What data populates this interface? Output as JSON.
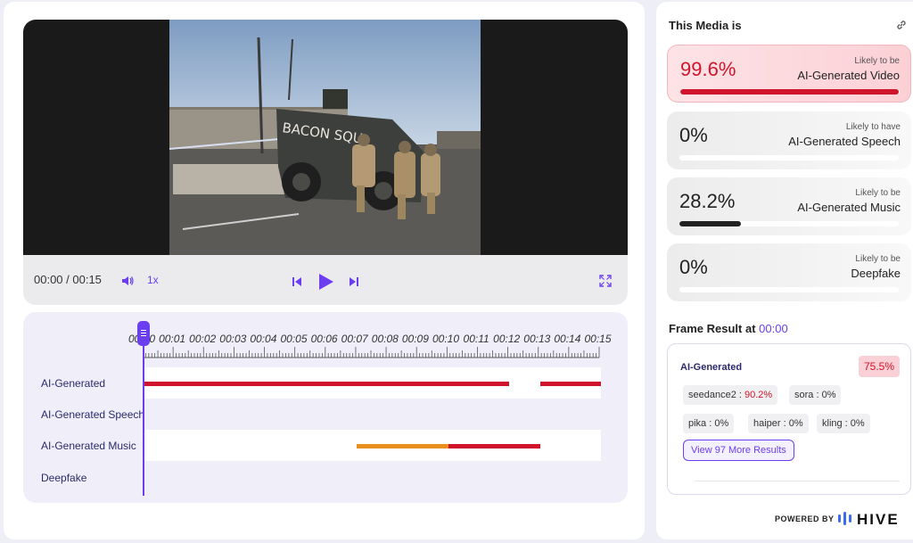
{
  "player": {
    "time": "00:00 / 00:15",
    "speed": "1x",
    "icons": [
      "volume-icon",
      "skip-back-icon",
      "play-icon",
      "skip-forward-icon",
      "fullscreen-icon"
    ],
    "video_text": "BACON SQU"
  },
  "timeline": {
    "ticks": [
      "00:00",
      "00:01",
      "00:02",
      "00:03",
      "00:04",
      "00:05",
      "00:06",
      "00:07",
      "00:08",
      "00:09",
      "00:10",
      "00:11",
      "00:12",
      "00:13",
      "00:14",
      "00:15"
    ],
    "tracks": [
      {
        "label": "AI-Generated",
        "segments": [
          {
            "start": 0,
            "end": 12.0,
            "color": "#d0142c"
          },
          {
            "start": 13.0,
            "end": 15.0,
            "color": "#d0142c"
          }
        ]
      },
      {
        "label": "AI-Generated Speech",
        "segments": []
      },
      {
        "label": "AI-Generated Music",
        "segments": [
          {
            "start": 7.0,
            "end": 10.0,
            "color": "#e8901e"
          },
          {
            "start": 10.0,
            "end": 13.0,
            "color": "#d0142c"
          }
        ]
      },
      {
        "label": "Deepfake",
        "segments": []
      }
    ]
  },
  "sidebar": {
    "title": "This Media is",
    "cards": [
      {
        "pct": "99.6%",
        "small": "Likely to be",
        "big": "AI-Generated Video",
        "fill": 0.996,
        "color": "#d0142c"
      },
      {
        "pct": "0%",
        "small": "Likely to have",
        "big": "AI-Generated Speech",
        "fill": 0,
        "color": "#222222"
      },
      {
        "pct": "28.2%",
        "small": "Likely to be",
        "big": "AI-Generated Music",
        "fill": 0.282,
        "color": "#222222"
      },
      {
        "pct": "0%",
        "small": "Likely to be",
        "big": "Deepfake",
        "fill": 0,
        "color": "#222222"
      }
    ],
    "frame_title": "Frame Result at",
    "frame_time": "00:00",
    "frame_label": "AI-Generated",
    "frame_score": "75.5%",
    "chips": [
      {
        "name": "seedance2",
        "value": "90.2%",
        "red": true
      },
      {
        "name": "sora",
        "value": "0%",
        "red": false
      },
      {
        "name": "pika",
        "value": "0%",
        "red": false
      },
      {
        "name": "haiper",
        "value": "0%",
        "red": false
      },
      {
        "name": "kling",
        "value": "0%",
        "red": false
      }
    ],
    "more_button": "View 97 More Results",
    "powered_by": "POWERED BY",
    "brand": "HIVE"
  }
}
